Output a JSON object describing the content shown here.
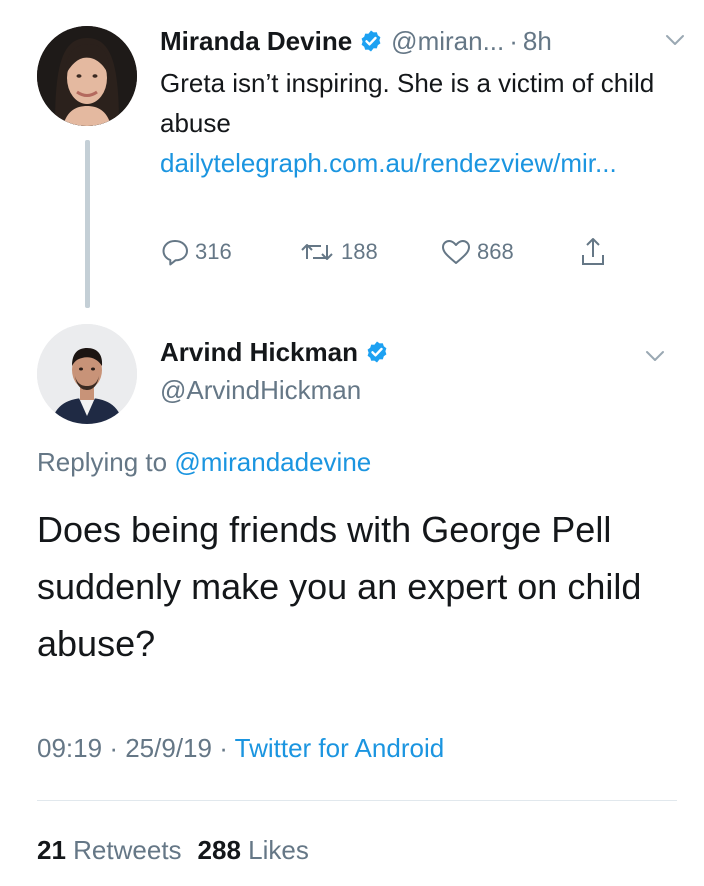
{
  "parent_tweet": {
    "author_name": "Miranda Devine",
    "verified": true,
    "handle": "@miran...",
    "separator": "·",
    "time": "8h",
    "text": "Greta isn’t inspiring. She is a victim of child abuse",
    "link": "dailytelegraph.com.au/rendezview/mir...",
    "actions": {
      "replies": "316",
      "retweets": "188",
      "likes": "868"
    },
    "icons": [
      "reply-icon",
      "retweet-icon",
      "like-icon",
      "share-icon",
      "chevron-down-icon",
      "verified-badge-icon"
    ]
  },
  "main_tweet": {
    "author_name": "Arvind Hickman",
    "verified": true,
    "handle": "@ArvindHickman",
    "replying_prefix": "Replying to",
    "replying_to": "@mirandadevine",
    "text": "Does being friends with George Pell suddenly make you an expert on child abuse?",
    "time": "09:19",
    "meta_sep_1": "·",
    "date": "25/9/19",
    "meta_sep_2": "·",
    "source": "Twitter for Android",
    "stats": {
      "retweets_count": "21",
      "retweets_label": "Retweets",
      "likes_count": "288",
      "likes_label": "Likes"
    }
  },
  "colors": {
    "text": "#14171a",
    "secondary": "#657786",
    "link": "#1b95e0",
    "verified": "#1da1f2",
    "thread_line": "#c4cfd6",
    "divider": "#e1e8ed"
  }
}
